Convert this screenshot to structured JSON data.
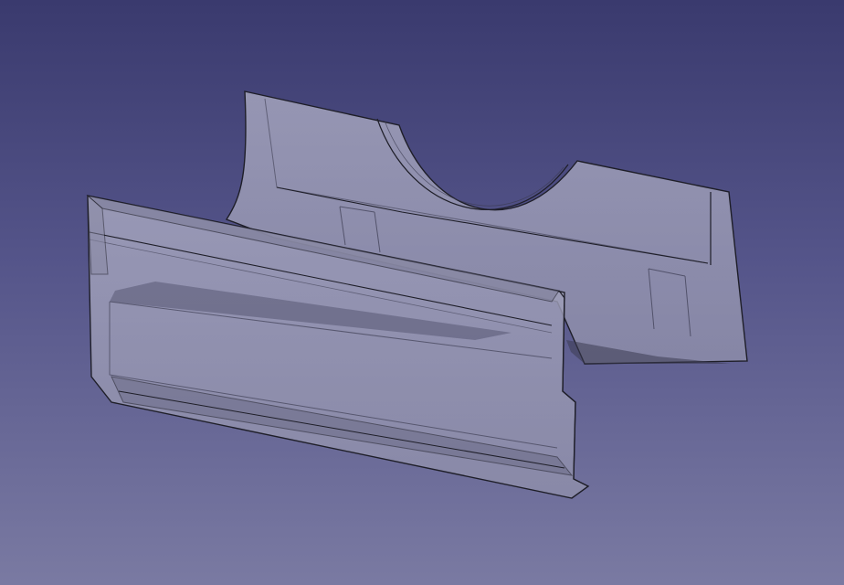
{
  "viewport": {
    "background_top": "#3a3a6e",
    "background_bottom": "#7a7aa2"
  },
  "model": {
    "object": "translucent-bracket-part",
    "face_color": "#9c9cb6",
    "face_dark_color": "#7c7c98",
    "edge_color": "#1e1e28"
  }
}
